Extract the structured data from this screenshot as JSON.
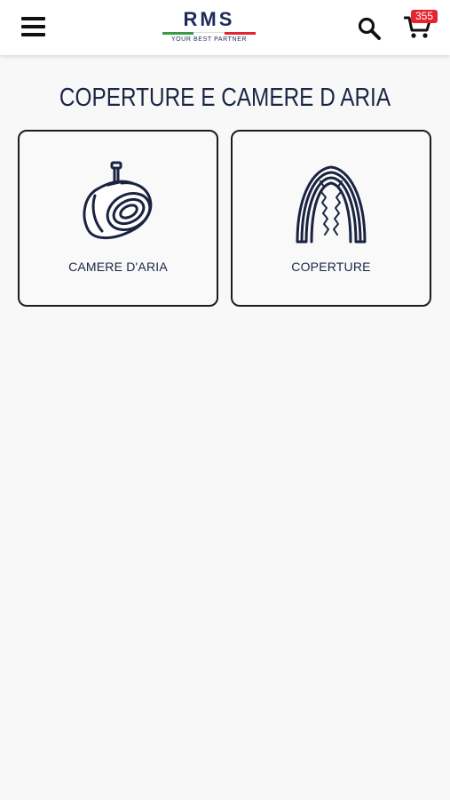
{
  "header": {
    "logo_text": "RMS",
    "logo_tagline": "YOUR BEST PARTNER",
    "cart_count": "355",
    "icons": {
      "menu": "hamburger-menu-icon",
      "search": "search-icon",
      "cart": "cart-icon"
    }
  },
  "page": {
    "title": "COPERTURE E CAMERE D ARIA"
  },
  "categories": [
    {
      "label": "CAMERE D'ARIA",
      "icon": "inner-tube-icon"
    },
    {
      "label": "COPERTURE",
      "icon": "tire-icon"
    }
  ],
  "colors": {
    "brand_navy": "#1d2a5b",
    "badge_red": "#e52431",
    "flag_green": "#3a9a44",
    "flag_red": "#e52431"
  }
}
